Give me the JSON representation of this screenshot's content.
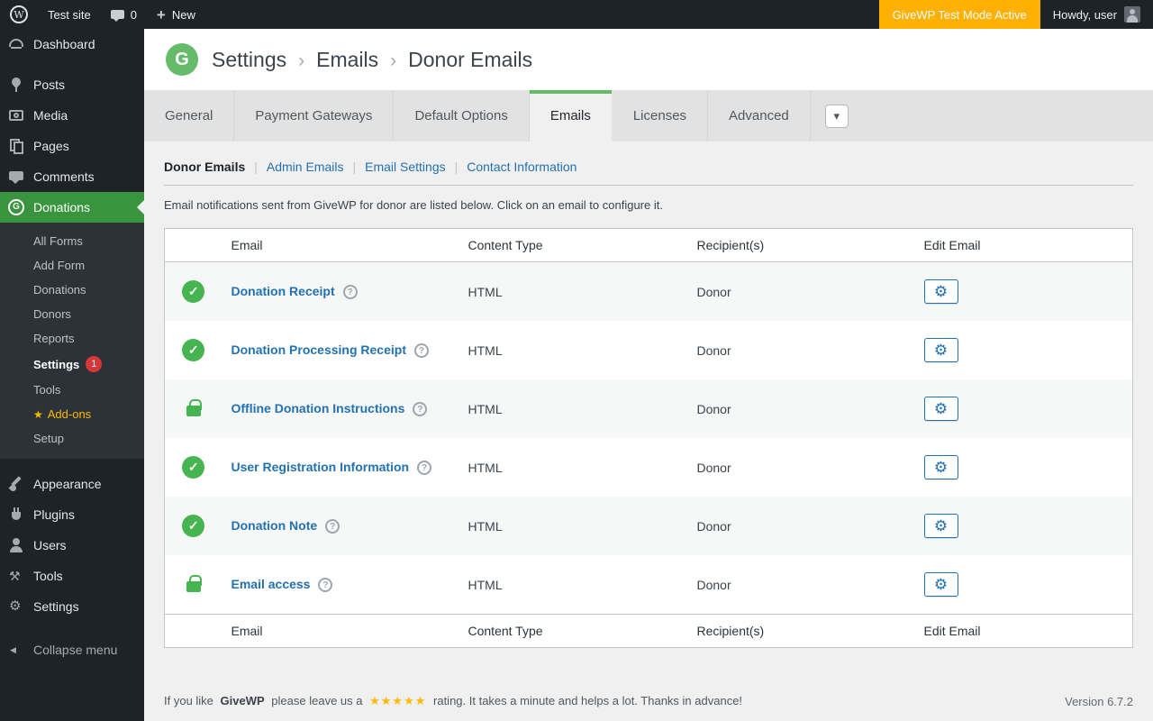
{
  "colors": {
    "give_green": "#66bb6a",
    "active_menu_green": "#38953d",
    "link_blue": "#2271b1",
    "status_green": "#46b450",
    "badge_red": "#d63638",
    "test_mode_orange": "#ffb000",
    "stars_orange": "#ffb900",
    "admin_dark": "#1d2327"
  },
  "admin_bar": {
    "site_name": "Test site",
    "comment_count": "0",
    "new_label": "New",
    "test_mode_label": "GiveWP Test Mode Active",
    "howdy_label": "Howdy, user"
  },
  "sidebar": {
    "top": [
      {
        "label": "Dashboard"
      },
      {
        "label": "Posts"
      },
      {
        "label": "Media"
      },
      {
        "label": "Pages"
      },
      {
        "label": "Comments"
      },
      {
        "label": "Donations"
      },
      {
        "label": "Appearance"
      },
      {
        "label": "Plugins"
      },
      {
        "label": "Users"
      },
      {
        "label": "Tools"
      },
      {
        "label": "Settings"
      },
      {
        "label": "Collapse menu"
      }
    ],
    "donations_submenu": {
      "items": [
        {
          "label": "All Forms"
        },
        {
          "label": "Add Form"
        },
        {
          "label": "Donations"
        },
        {
          "label": "Donors"
        },
        {
          "label": "Reports"
        },
        {
          "label": "Settings",
          "badge": "1"
        },
        {
          "label": "Tools"
        },
        {
          "label": "Add-ons"
        },
        {
          "label": "Setup"
        }
      ]
    }
  },
  "header": {
    "breadcrumb": [
      {
        "label": "Settings"
      },
      {
        "label": "Emails"
      },
      {
        "label": "Donor Emails"
      }
    ]
  },
  "tabs": {
    "items": [
      {
        "label": "General"
      },
      {
        "label": "Payment Gateways"
      },
      {
        "label": "Default Options"
      },
      {
        "label": "Emails"
      },
      {
        "label": "Licenses"
      },
      {
        "label": "Advanced"
      }
    ]
  },
  "subnav": {
    "items": [
      {
        "label": "Donor Emails"
      },
      {
        "label": "Admin Emails"
      },
      {
        "label": "Email Settings"
      },
      {
        "label": "Contact Information"
      }
    ]
  },
  "intro": "Email notifications sent from GiveWP for donor are listed below. Click on an email to configure it.",
  "table": {
    "headers": {
      "email": "Email",
      "content_type": "Content Type",
      "recipients": "Recipient(s)",
      "edit": "Edit Email"
    },
    "rows": [
      {
        "status": "enabled",
        "email": "Donation Receipt",
        "content_type": "HTML",
        "recipients": "Donor"
      },
      {
        "status": "enabled",
        "email": "Donation Processing Receipt",
        "content_type": "HTML",
        "recipients": "Donor"
      },
      {
        "status": "locked",
        "email": "Offline Donation Instructions",
        "content_type": "HTML",
        "recipients": "Donor"
      },
      {
        "status": "enabled",
        "email": "User Registration Information",
        "content_type": "HTML",
        "recipients": "Donor"
      },
      {
        "status": "enabled",
        "email": "Donation Note",
        "content_type": "HTML",
        "recipients": "Donor"
      },
      {
        "status": "locked",
        "email": "Email access",
        "content_type": "HTML",
        "recipients": "Donor"
      }
    ]
  },
  "footer": {
    "prefix": "If you like",
    "brand": "GiveWP",
    "middle": "please leave us a",
    "stars": "★★★★★",
    "suffix": "rating. It takes a minute and helps a lot. Thanks in advance!",
    "version": "Version 6.7.2"
  }
}
